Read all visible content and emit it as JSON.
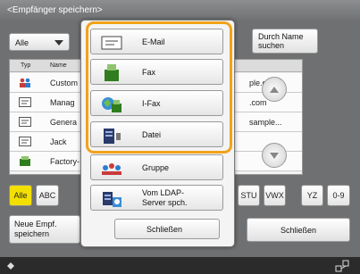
{
  "title": "<Empfänger speichern>",
  "filter": {
    "value": "Alle"
  },
  "search_button": {
    "label": "Durch Name suchen"
  },
  "list": {
    "col_type": "Typ",
    "col_name": "Name",
    "rows": [
      {
        "name": "Custom",
        "address": "ple.com",
        "icon": "group-icon"
      },
      {
        "name": "Manag",
        "address": ".com",
        "icon": "email-icon"
      },
      {
        "name": "Genera",
        "address": "sample...",
        "icon": "email-icon"
      },
      {
        "name": "Jack",
        "address": "",
        "icon": "email-icon"
      },
      {
        "name": "Factory-",
        "address": "",
        "icon": "fax-icon"
      }
    ]
  },
  "letters": [
    "Alle",
    "ABC",
    "STU",
    "VWX",
    "YZ",
    "0-9"
  ],
  "bottom": {
    "new_entry": "Neue Empf. speichern",
    "close": "Schließen"
  },
  "popup": {
    "email": "E-Mail",
    "fax": "Fax",
    "ifax": "I-Fax",
    "file": "Datei",
    "group": "Gruppe",
    "ldap_line1": "Vom LDAP-",
    "ldap_line2": "Server spch.",
    "close": "Schließen"
  },
  "colors": {
    "highlight": "#f1a21a",
    "accent_green": "#2f7d1e",
    "accent_yellow": "#f3e000"
  }
}
